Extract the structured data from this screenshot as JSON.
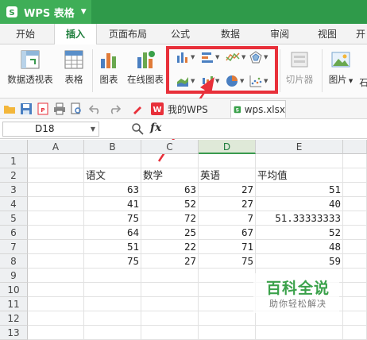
{
  "app": {
    "title": "WPS 表格"
  },
  "menu": {
    "tabs": [
      {
        "label": "开始"
      },
      {
        "label": "插入",
        "active": true
      },
      {
        "label": "页面布局"
      },
      {
        "label": "公式"
      },
      {
        "label": "数据"
      },
      {
        "label": "审阅"
      },
      {
        "label": "视图"
      },
      {
        "label": "开"
      }
    ]
  },
  "ribbon": {
    "pivot_table": "数据透视表",
    "table": "表格",
    "chart": "图表",
    "online_chart": "在线图表",
    "slicer": "切片器",
    "picture": "图片",
    "more": "石"
  },
  "quick_access": {
    "doc_tabs": [
      {
        "label": "我的WPS"
      },
      {
        "label": "wps.xlsx",
        "active": true
      }
    ]
  },
  "formula_bar": {
    "cell_ref": "D18",
    "fx_label": "fx",
    "value": ""
  },
  "sheet": {
    "columns": [
      "A",
      "B",
      "C",
      "D",
      "E"
    ],
    "selected_column": "D",
    "rows": [
      {
        "num": "1",
        "cells": [
          "",
          "",
          "",
          "",
          ""
        ]
      },
      {
        "num": "2",
        "cells": [
          "",
          "语文",
          "数学",
          "英语",
          "平均值"
        ]
      },
      {
        "num": "3",
        "cells": [
          "",
          "63",
          "63",
          "27",
          "51"
        ]
      },
      {
        "num": "4",
        "cells": [
          "",
          "41",
          "52",
          "27",
          "40"
        ]
      },
      {
        "num": "5",
        "cells": [
          "",
          "75",
          "72",
          "7",
          "51.33333333"
        ]
      },
      {
        "num": "6",
        "cells": [
          "",
          "64",
          "25",
          "67",
          "52"
        ]
      },
      {
        "num": "7",
        "cells": [
          "",
          "51",
          "22",
          "71",
          "48"
        ]
      },
      {
        "num": "8",
        "cells": [
          "",
          "75",
          "27",
          "75",
          "59"
        ]
      },
      {
        "num": "9",
        "cells": [
          "",
          "",
          "",
          "",
          ""
        ]
      },
      {
        "num": "10",
        "cells": [
          "",
          "",
          "",
          "",
          ""
        ]
      },
      {
        "num": "11",
        "cells": [
          "",
          "",
          "",
          "",
          ""
        ]
      },
      {
        "num": "12",
        "cells": [
          "",
          "",
          "",
          "",
          ""
        ]
      },
      {
        "num": "13",
        "cells": [
          "",
          "",
          "",
          "",
          ""
        ]
      }
    ]
  },
  "watermark": {
    "title": "百科全说",
    "subtitle": "助你轻松解决"
  },
  "colors": {
    "brand_green": "#2f9a4a",
    "highlight_red": "#e8303a"
  }
}
